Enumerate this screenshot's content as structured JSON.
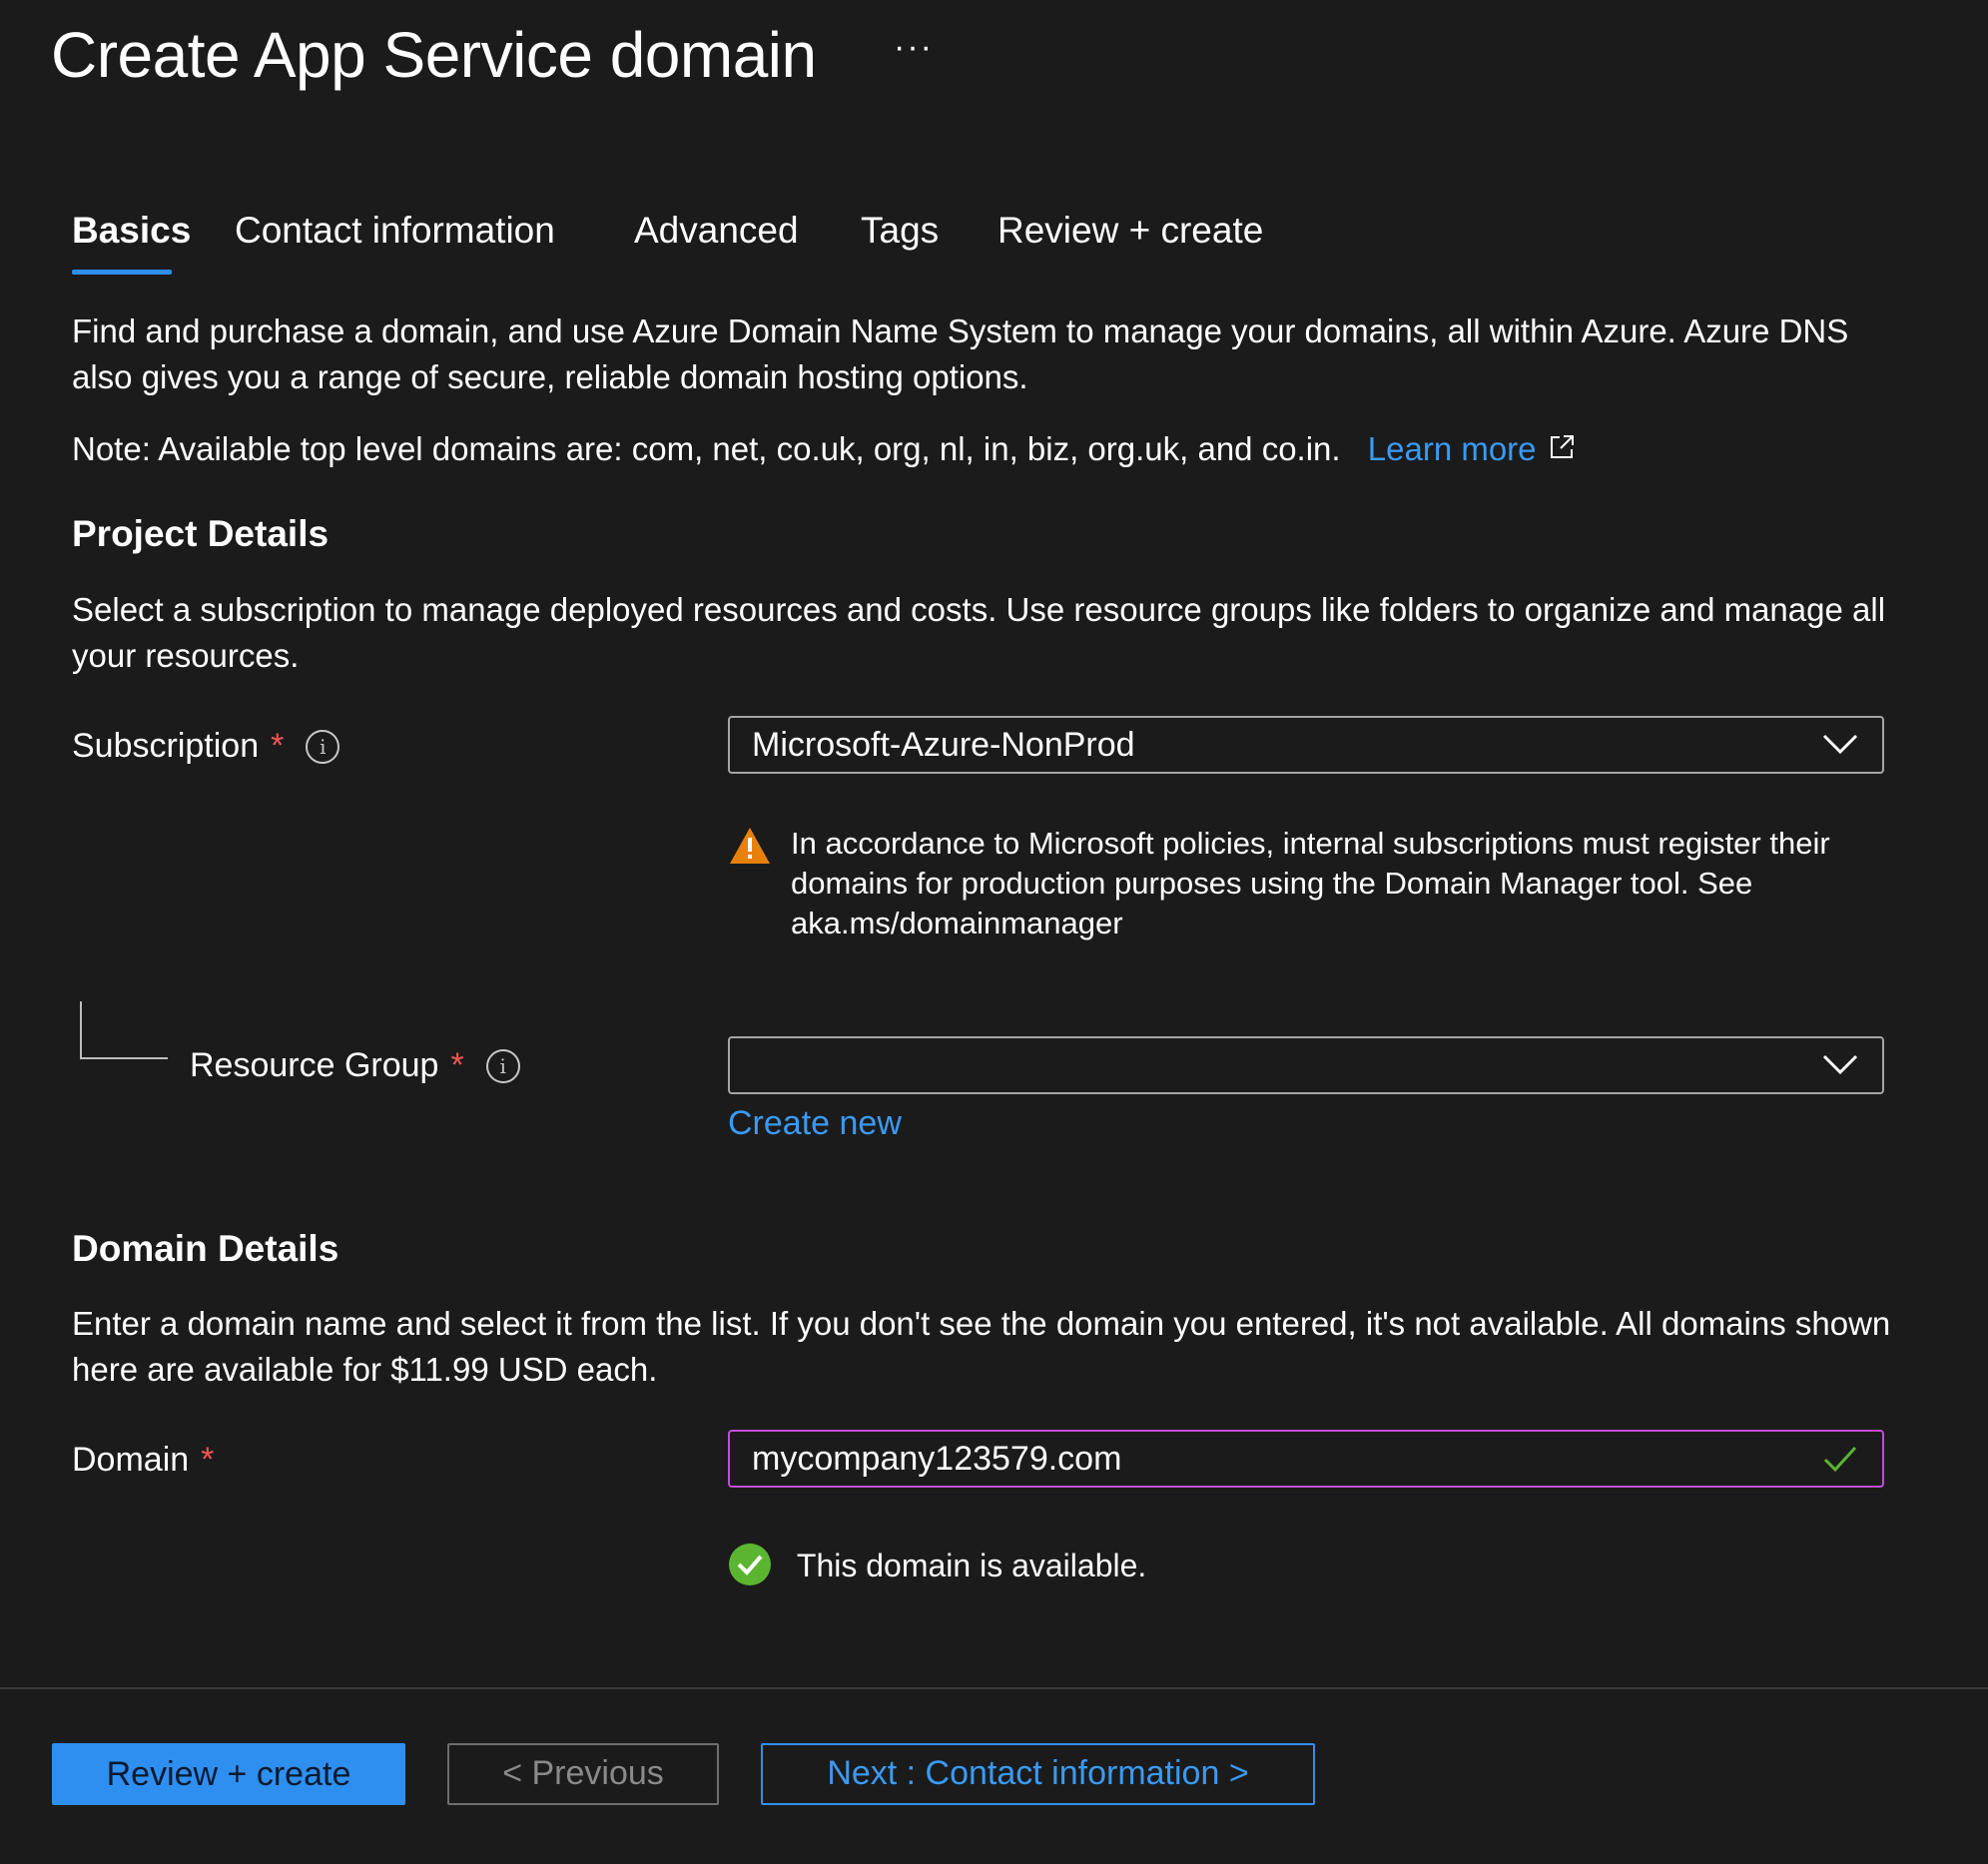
{
  "header": {
    "title": "Create App Service domain",
    "more_label": "···"
  },
  "tabs": [
    {
      "label": "Basics"
    },
    {
      "label": "Contact information"
    },
    {
      "label": "Advanced"
    },
    {
      "label": "Tags"
    },
    {
      "label": "Review + create"
    }
  ],
  "intro": {
    "text": "Find and purchase a domain, and use Azure Domain Name System to manage your domains, all within Azure. Azure DNS also gives you a range of secure, reliable domain hosting options.",
    "note": "Note: Available top level domains are: com, net, co.uk, org, nl, in, biz, org.uk, and co.in.",
    "learn_more": "Learn more"
  },
  "project": {
    "heading": "Project Details",
    "description": "Select a subscription to manage deployed resources and costs. Use resource groups like folders to organize and manage all your resources.",
    "subscription_label": "Subscription",
    "subscription_value": "Microsoft-Azure-NonProd",
    "warning": "In accordance to Microsoft policies, internal subscriptions must register their domains for production purposes using the Domain Manager tool. See aka.ms/domainmanager",
    "resource_group_label": "Resource Group",
    "resource_group_value": "",
    "create_new": "Create new"
  },
  "domain": {
    "heading": "Domain Details",
    "description": "Enter a domain name and select it from the list. If you don't see the domain you entered, it's not available. All domains shown here are available for $11.99 USD each.",
    "label": "Domain",
    "value": "mycompany123579.com",
    "status": "This domain is available."
  },
  "footer": {
    "review_create": "Review + create",
    "previous": "< Previous",
    "next": "Next : Contact information >"
  },
  "colors": {
    "accent": "#2f8ff0",
    "required": "#f25555",
    "warning": "#e8810c",
    "success": "#5cb531",
    "focus_border": "#c04fd8"
  }
}
